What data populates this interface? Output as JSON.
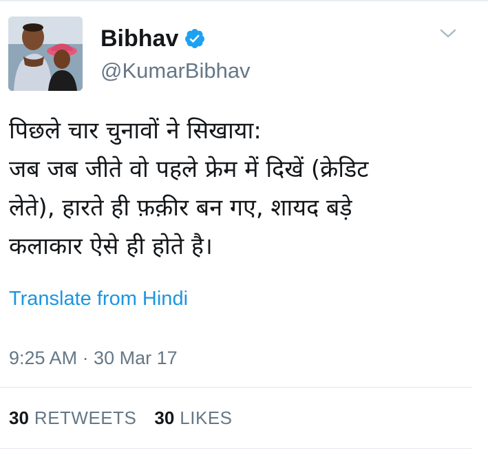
{
  "tweet": {
    "author": {
      "display_name": "Bibhav",
      "handle": "@KumarBibhav",
      "verified": true,
      "avatar_icon": "profile-photo"
    },
    "menu_icon": "chevron-down-icon",
    "text": "पिछले चार चुनावों ने सिखाया:\nजब जब जीते वो पहले फ्रेम में दिखें (क्रेडिट\nलेते), हारते ही फ़क़ीर बन गए, शायद बड़े\nकलाकार ऐसे ही होते है।",
    "translate_link": "Translate from Hindi",
    "timestamp": "9:25 AM · 30 Mar 17",
    "stats": {
      "retweets_count": "30",
      "retweets_label": "RETWEETS",
      "likes_count": "30",
      "likes_label": "LIKES"
    }
  },
  "colors": {
    "text": "#14171a",
    "secondary": "#657786",
    "link": "#1b95e0",
    "verified_badge": "#1da1f2",
    "divider": "#e1e8ed"
  }
}
